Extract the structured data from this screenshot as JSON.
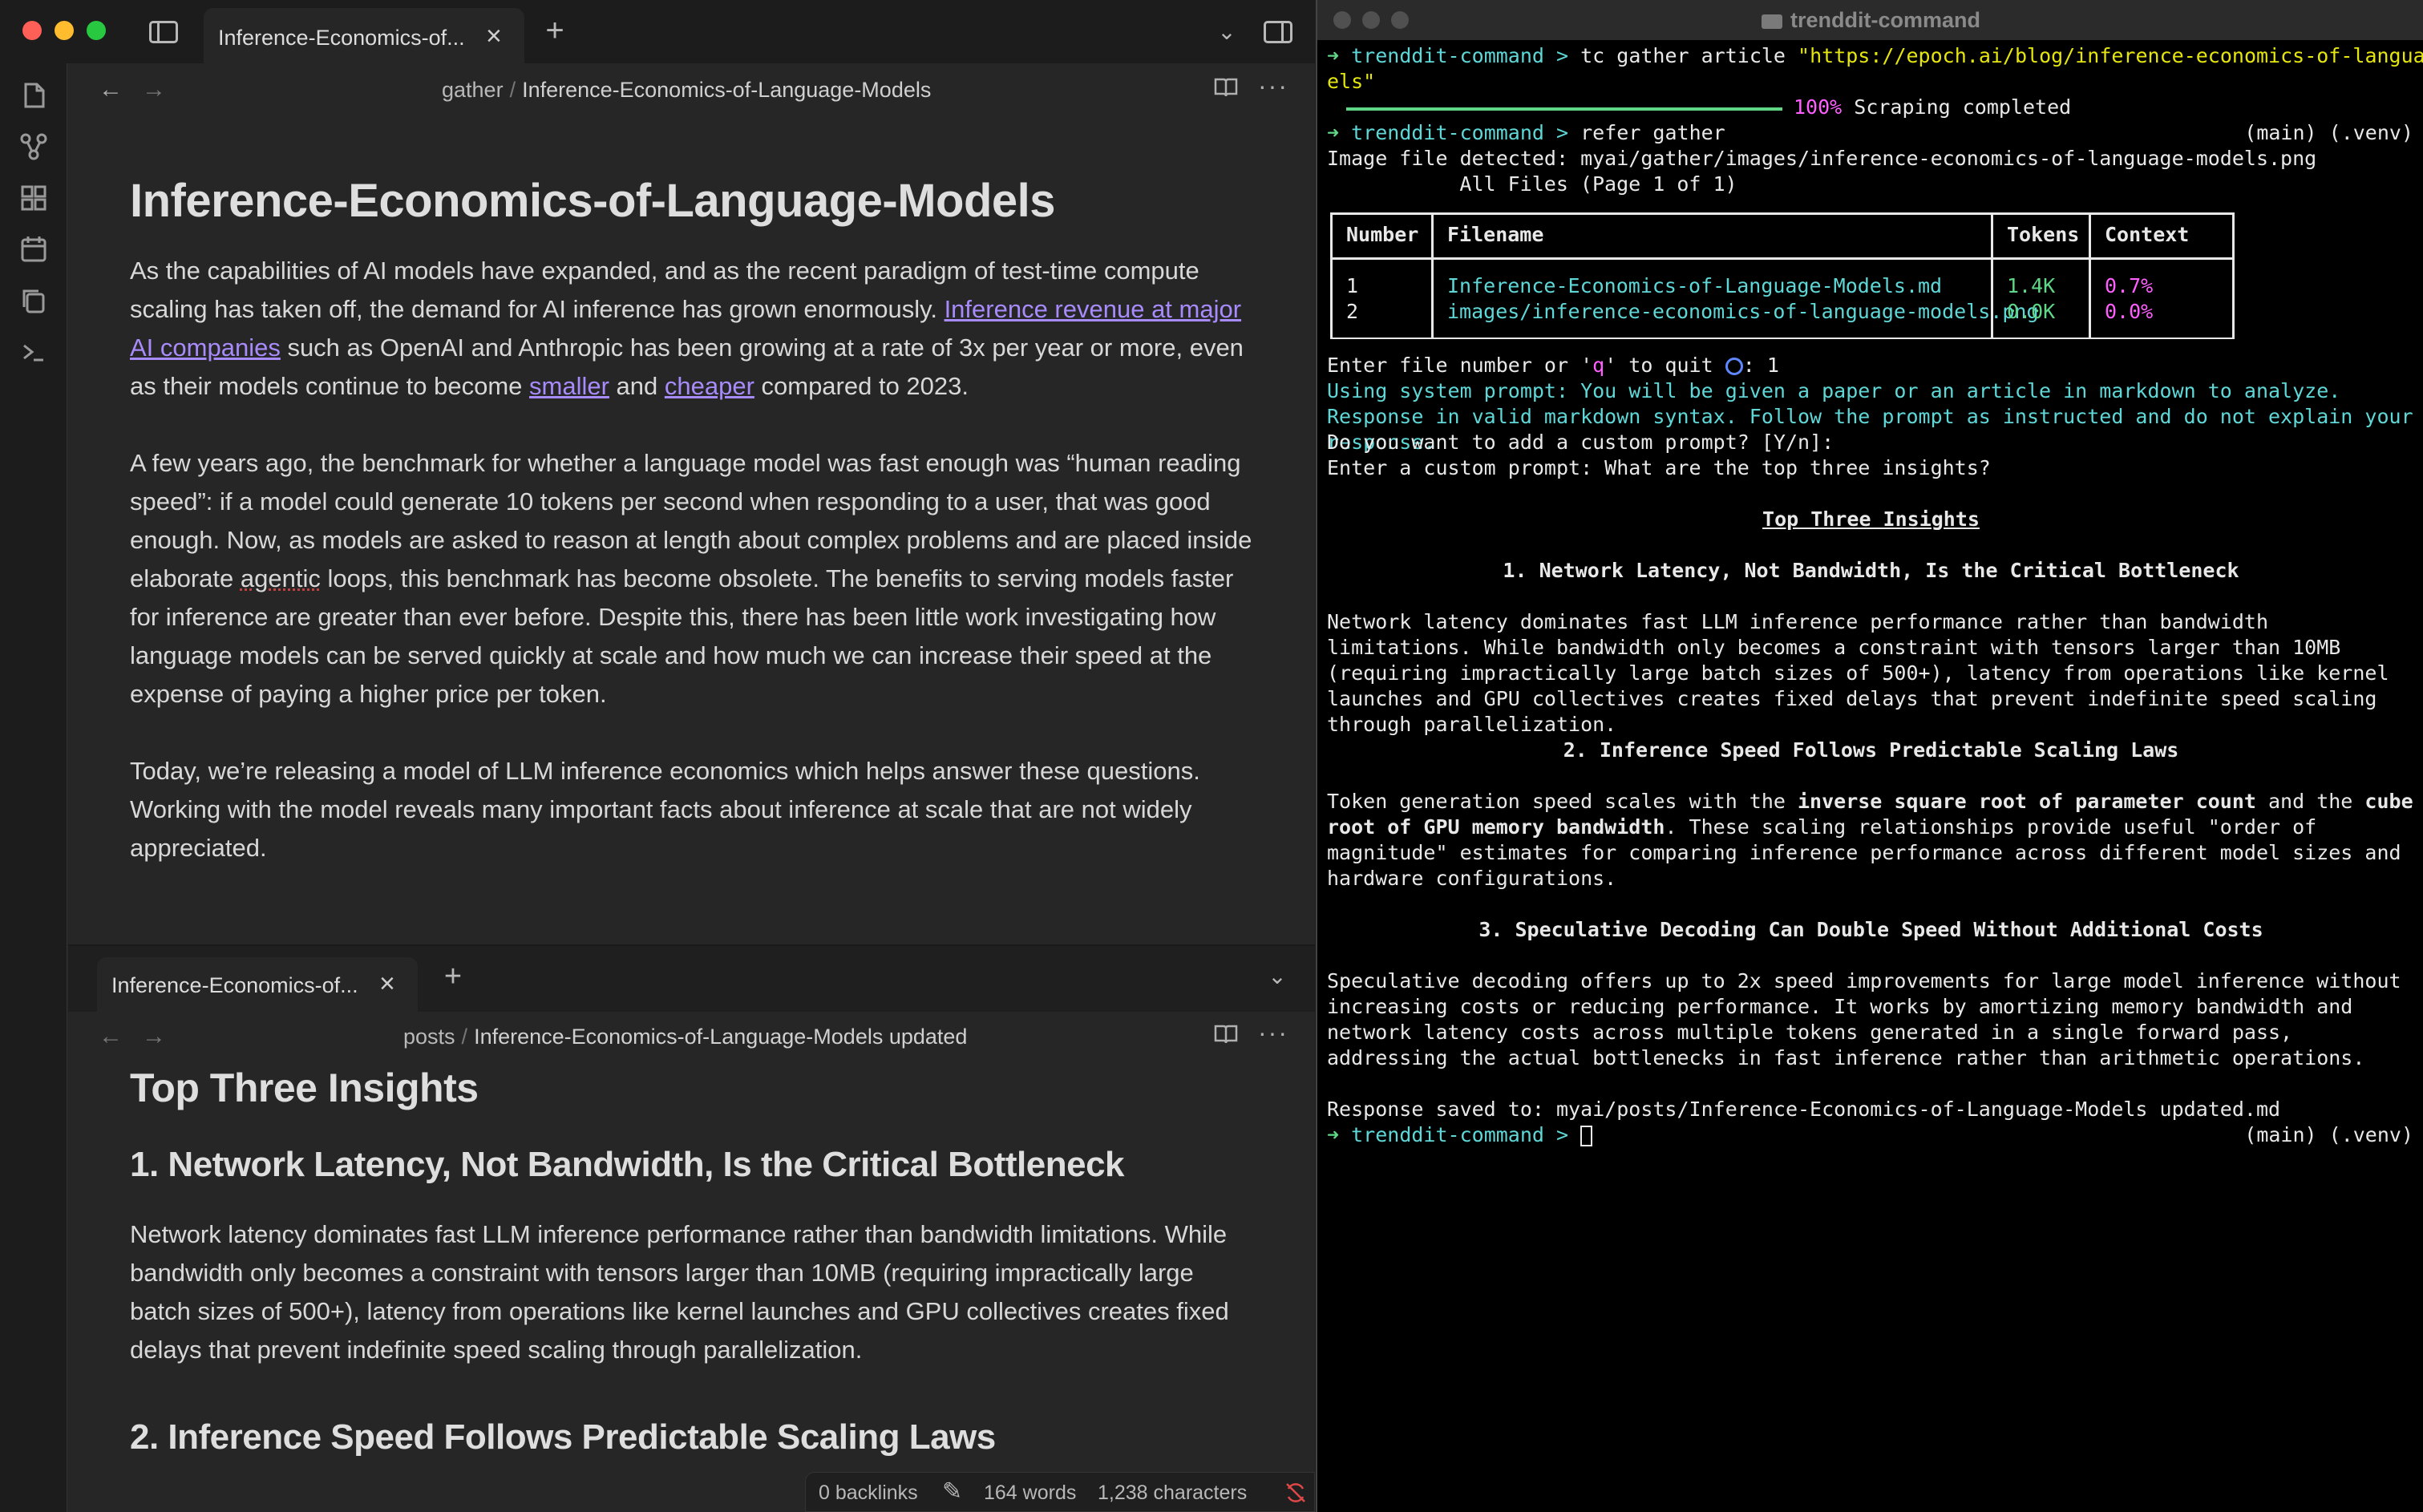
{
  "editor": {
    "tab_title": "Inference-Economics-of...",
    "breadcrumb_folder": "gather",
    "breadcrumb_file": "Inference-Economics-of-Language-Models",
    "doc_title": "Inference-Economics-of-Language-Models",
    "p1_a": "As the capabilities of AI models have expanded, and as the recent paradigm of test-time compute scaling has taken off, the demand for AI inference has grown enormously. ",
    "p1_link1": "Inference revenue at major AI companies",
    "p1_b": " such as OpenAI and Anthropic has been growing at a rate of 3x per year or more, even as their models continue to become ",
    "p1_link2": "smaller",
    "p1_c": " and ",
    "p1_link3": "cheaper",
    "p1_d": " compared to 2023.",
    "p2_a": "A few years ago, the benchmark for whether a language model was fast enough was “human reading speed”: if a model could generate 10 tokens per second when responding to a user, that was good enough. Now, as models are asked to reason at length about complex problems and are placed inside elaborate ",
    "p2_spell": "agentic",
    "p2_b": " loops, this benchmark has become obsolete. The benefits to serving models faster for inference are greater than ever before. Despite this, there has been little work investigating how language models can be served quickly at scale and how much we can increase their speed at the expense of paying a higher price per token.",
    "p3": "Today, we’re releasing a model of LLM inference economics which helps answer these questions. Working with the model reveals many important facts about inference at scale that are not widely appreciated."
  },
  "editor_bottom": {
    "tab_title": "Inference-Economics-of...",
    "breadcrumb_folder": "posts",
    "breadcrumb_file": "Inference-Economics-of-Language-Models updated",
    "h1": "Top Three Insights",
    "h2_1": "1. Network Latency, Not Bandwidth, Is the Critical Bottleneck",
    "p1": "Network latency dominates fast LLM inference performance rather than bandwidth limitations. While bandwidth only becomes a constraint with tensors larger than 10MB (requiring impractically large batch sizes of 500+), latency from operations like kernel launches and GPU collectives creates fixed delays that prevent indefinite speed scaling through parallelization.",
    "h2_2": "2. Inference Speed Follows Predictable Scaling Laws"
  },
  "statusbar": {
    "backlinks": "0 backlinks",
    "words": "164 words",
    "characters": "1,238 characters"
  },
  "terminal": {
    "title": "trenddit-command",
    "prompt": "trenddit-command > ",
    "cmd1": "tc gather article ",
    "url1": "\"https://epoch.ai/blog/inference-economics-of-language-mod",
    "url2": "els\"",
    "progress_pct": "100%",
    "progress_text": " Scraping completed",
    "cmd2": "refer gather",
    "git_info": "(main) (.venv)",
    "image_detected": "Image file detected: myai/gather/images/inference-economics-of-language-models.png",
    "files_header": "All Files (Page 1 of 1)",
    "table_headers": [
      "Number",
      "Filename",
      "Tokens",
      "Context"
    ],
    "table_rows": [
      {
        "number": "1",
        "filename": "Inference-Economics-of-Language-Models.md",
        "tokens": "1.4K",
        "context": "0.7%"
      },
      {
        "number": "2",
        "filename": "images/inference-economics-of-language-models.png",
        "tokens": "0.0K",
        "context": "0.0%"
      }
    ],
    "enter_file_a": "Enter file number or '",
    "enter_file_q": "q",
    "enter_file_b": "' to quit ",
    "enter_file_c": ": 1",
    "system_prompt": "Using system prompt: You will be given a paper or an article in markdown to analyze. Response in valid markdown syntax. Follow the prompt as instructed and do not explain your response.",
    "custom_q": "Do you want to add a custom prompt? [Y/n]:",
    "custom_prompt": "Enter a custom prompt: What are the top three insights?",
    "insights_title": "Top Three Insights",
    "insight1_title": "1. Network Latency, Not Bandwidth, Is the Critical Bottleneck",
    "insight1_body": "Network latency dominates fast LLM inference performance rather than bandwidth limitations. While bandwidth only becomes a constraint with tensors larger than 10MB (requiring impractically large batch sizes of 500+), latency from operations like kernel launches and GPU collectives creates fixed delays that prevent indefinite speed scaling through parallelization.",
    "insight2_title": "2. Inference Speed Follows Predictable Scaling Laws",
    "insight2_a": "Token generation speed scales with the ",
    "insight2_b1": "inverse square root of parameter count",
    "insight2_c": " and the ",
    "insight2_b2": "cube root of GPU memory bandwidth",
    "insight2_d": ". These scaling relationships provide useful \"order of magnitude\" estimates for comparing inference performance across different model sizes and hardware configurations.",
    "insight3_title": "3. Speculative Decoding Can Double Speed Without Additional Costs",
    "insight3_body": "Speculative decoding offers up to 2x speed improvements for large model inference without increasing costs or reducing performance. It works by amortizing memory bandwidth and network latency costs across multiple tokens generated in a single forward pass, addressing the actual bottlenecks in fast inference rather than arithmetic operations.",
    "saved": "Response saved to: myai/posts/Inference-Economics-of-Language-Models updated.md"
  },
  "icons": {
    "close": "×",
    "plus": "+",
    "chevron": "⌄",
    "back": "←",
    "forward": "→",
    "book": "⧉",
    "more": "···",
    "arrow": "➜",
    "pencil": "✎"
  },
  "colors": {
    "link": "#a88bfa",
    "prompt_green": "#5fd787",
    "url_yellow": "#e5e510",
    "cyan": "#5fd7d7",
    "magenta": "#ff5fff"
  }
}
